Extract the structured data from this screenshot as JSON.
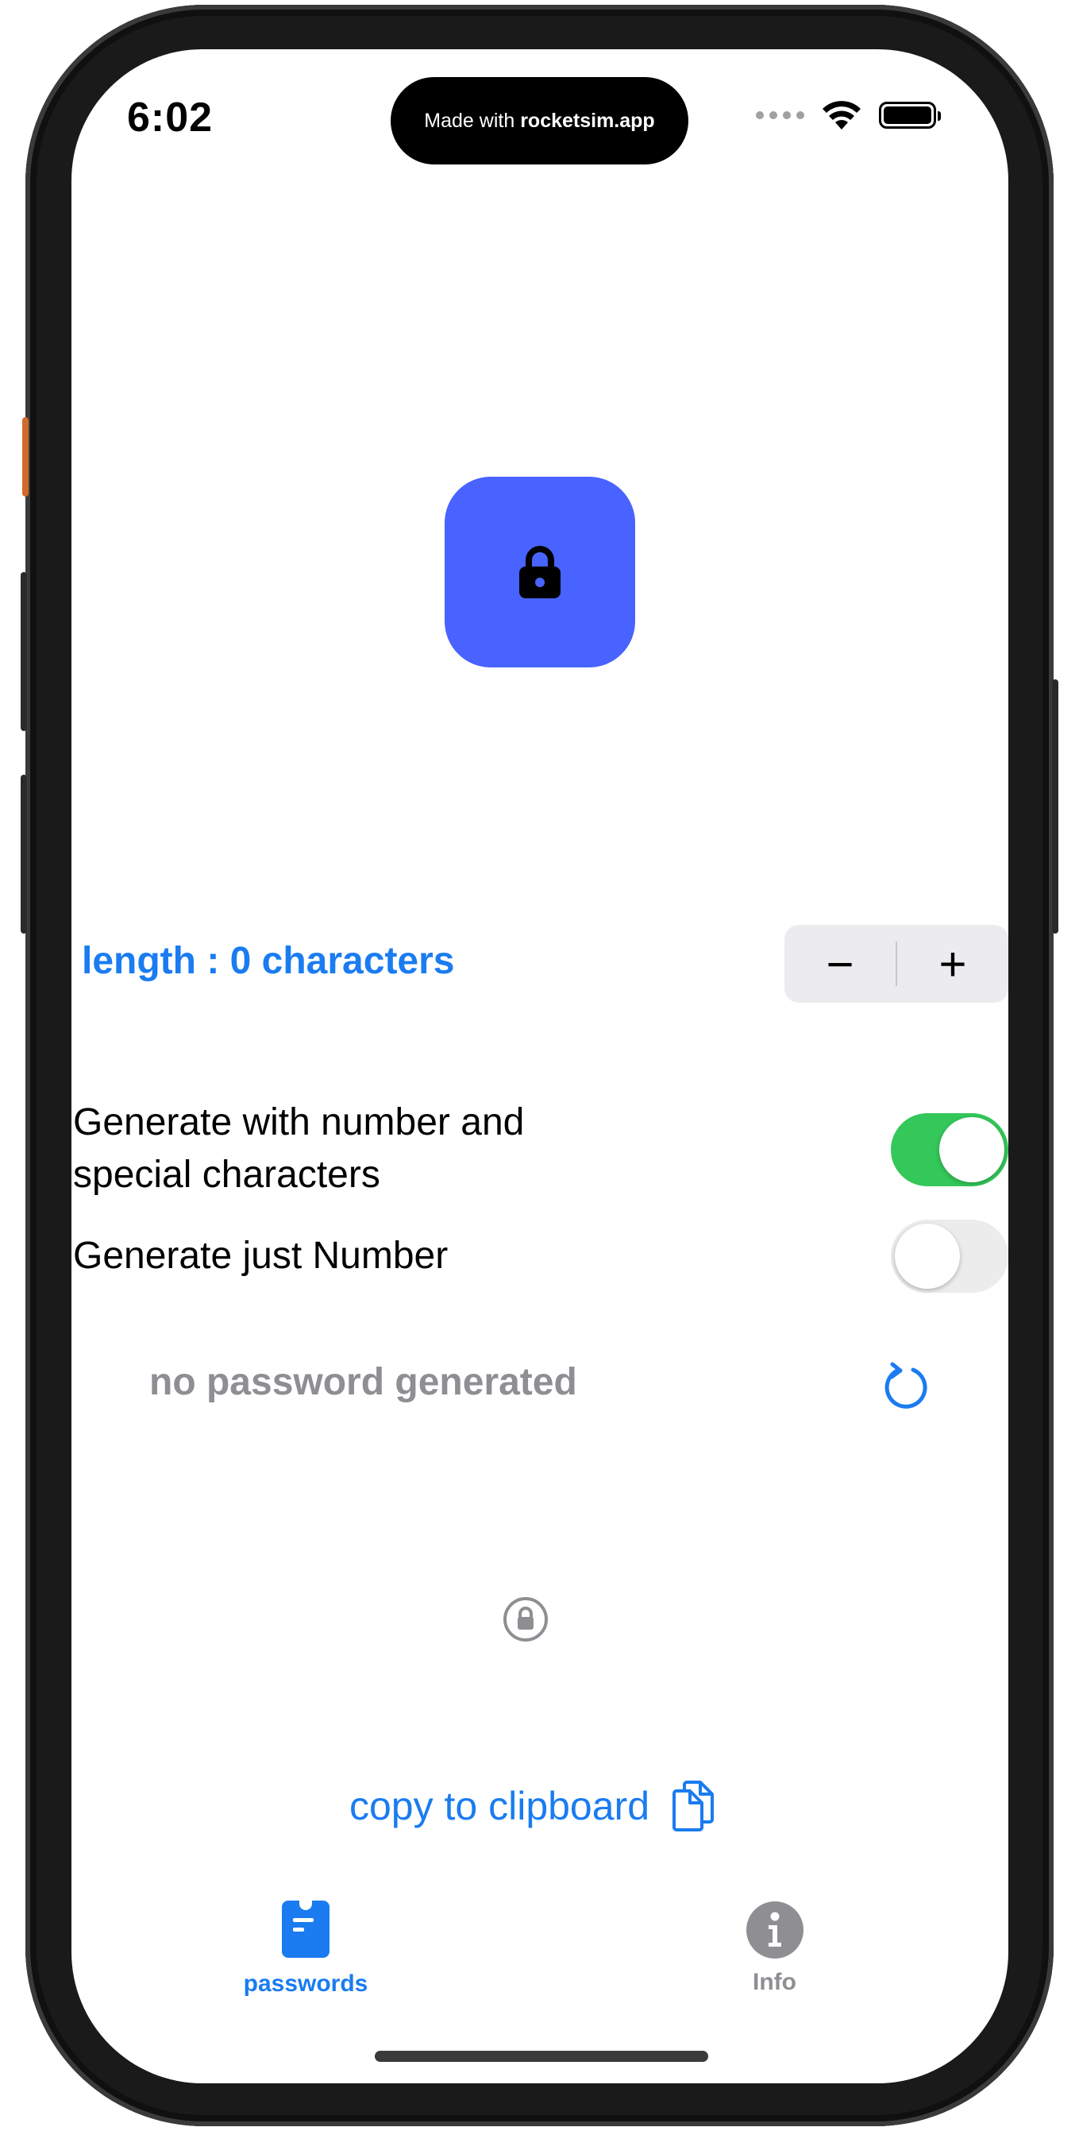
{
  "status_bar": {
    "time": "6:02",
    "island_prefix": "Made with ",
    "island_brand": "rocketsim.app"
  },
  "app": {
    "icon": "lock-icon",
    "accent_color": "#4863ff"
  },
  "length": {
    "label": "length : 0 characters",
    "stepper_minus": "−",
    "stepper_plus": "+"
  },
  "options": [
    {
      "label": "Generate with number and special characters",
      "enabled": true
    },
    {
      "label": "Generate just Number",
      "enabled": false
    }
  ],
  "password": {
    "text": "no password generated",
    "refresh_icon": "refresh-icon",
    "status_icon": "lock-circle-icon"
  },
  "copy": {
    "label": "copy to clipboard",
    "icon": "copy-document-icon"
  },
  "tab_bar": {
    "tabs": [
      {
        "label": "passwords",
        "icon": "clipboard-icon",
        "active": true
      },
      {
        "label": "Info",
        "icon": "info-icon",
        "active": false
      }
    ],
    "active_color": "#1a7cf0",
    "inactive_color": "#8e8e93"
  }
}
